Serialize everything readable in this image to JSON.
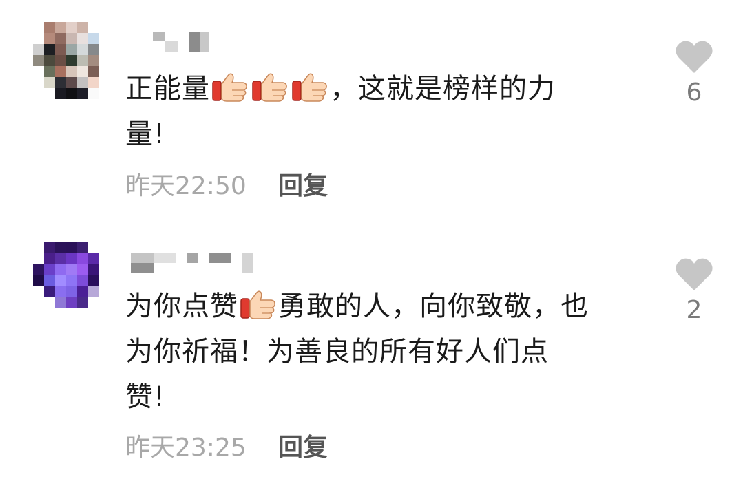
{
  "comments": [
    {
      "avatar_colors": [
        "#ffffff",
        "#a97d6e",
        "#c8a79a",
        "#e2cfc8",
        "#cdb3a8",
        "#ffffff",
        "#ffffff",
        "#ffffff",
        "#b58a7b",
        "#8f6a60",
        "#c9b7b1",
        "#e8e0de",
        "#c7d9ea",
        "#ffffff",
        "#cfcfcf",
        "#1d1f23",
        "#7c5a52",
        "#9ba7a5",
        "#d4d9da",
        "#86898b",
        "#ffffff",
        "#8f8a7f",
        "#4c4a3d",
        "#6a4e45",
        "#2f3b2f",
        "#bcbcb2",
        "#a38c80",
        "#ffffff",
        "#ffffff",
        "#69705c",
        "#a8705f",
        "#d7c5ba",
        "#efe6df",
        "#7b5e55",
        "#ffffff",
        "#ffffff",
        "#d9d7c9",
        "#2d2e35",
        "#5d4a4b",
        "#c3c0c0",
        "#f2d5c8",
        "#ffffff",
        "#ffffff",
        "#ffffff",
        "#1a1a22",
        "#101014",
        "#1e1e28",
        "#fafafa",
        "#ffffff"
      ],
      "username_blocks": [
        "#b9b9b9",
        "#d9d9d9",
        "#8c8c8c",
        "#c8c8c8"
      ],
      "text_line1_before": "正能量",
      "text_line1_after": "，这就是榜样的力",
      "text_line2": "量!",
      "time": "昨天22:50",
      "reply_label": "回复",
      "like_count": "6",
      "thumb_icon": "thumbs-up-emoji",
      "heart_icon": "heart-icon"
    },
    {
      "avatar_colors": [
        "#ffffff",
        "#3a1a6e",
        "#2b1259",
        "#2a1158",
        "#3b1f70",
        "#ffffff",
        "#ffffff",
        "#ffffff",
        "#4a1f8a",
        "#5b2fa6",
        "#6b36c3",
        "#8a49e0",
        "#5a2aa8",
        "#ffffff",
        "#2e1460",
        "#6a3fc9",
        "#8f6af0",
        "#a07af5",
        "#9c5cf0",
        "#3a1578",
        "#ffffff",
        "#1f0c48",
        "#6b5ce0",
        "#a18cff",
        "#8e74f5",
        "#7d4cd9",
        "#2a0f5c",
        "#ffffff",
        "#ffffff",
        "#3a1b7c",
        "#8a6ef0",
        "#7e63e6",
        "#4b1f96",
        "#b7a8d8",
        "#ffffff",
        "#ffffff",
        "#ffffff",
        "#8f78d6",
        "#6e3fc2",
        "#4a2a8a",
        "#ffffff",
        "#ffffff",
        "#ffffff",
        "#ffffff",
        "#ffffff",
        "#ffffff",
        "#ffffff",
        "#ffffff",
        "#ffffff"
      ],
      "username_blocks": [
        "#c4c4c4",
        "#e0e0e0",
        "#8f8f8f",
        "#a5a5a5",
        "#d4d4d4"
      ],
      "text_line1_before": "为你点赞",
      "text_line1_after": "勇敢的人，向你致敬，也",
      "text_line2": "为你祈福！为善良的所有好人们点",
      "text_line3": "赞!",
      "time": "昨天23:25",
      "reply_label": "回复",
      "like_count": "2",
      "thumb_icon": "thumbs-up-emoji",
      "heart_icon": "heart-icon"
    }
  ]
}
